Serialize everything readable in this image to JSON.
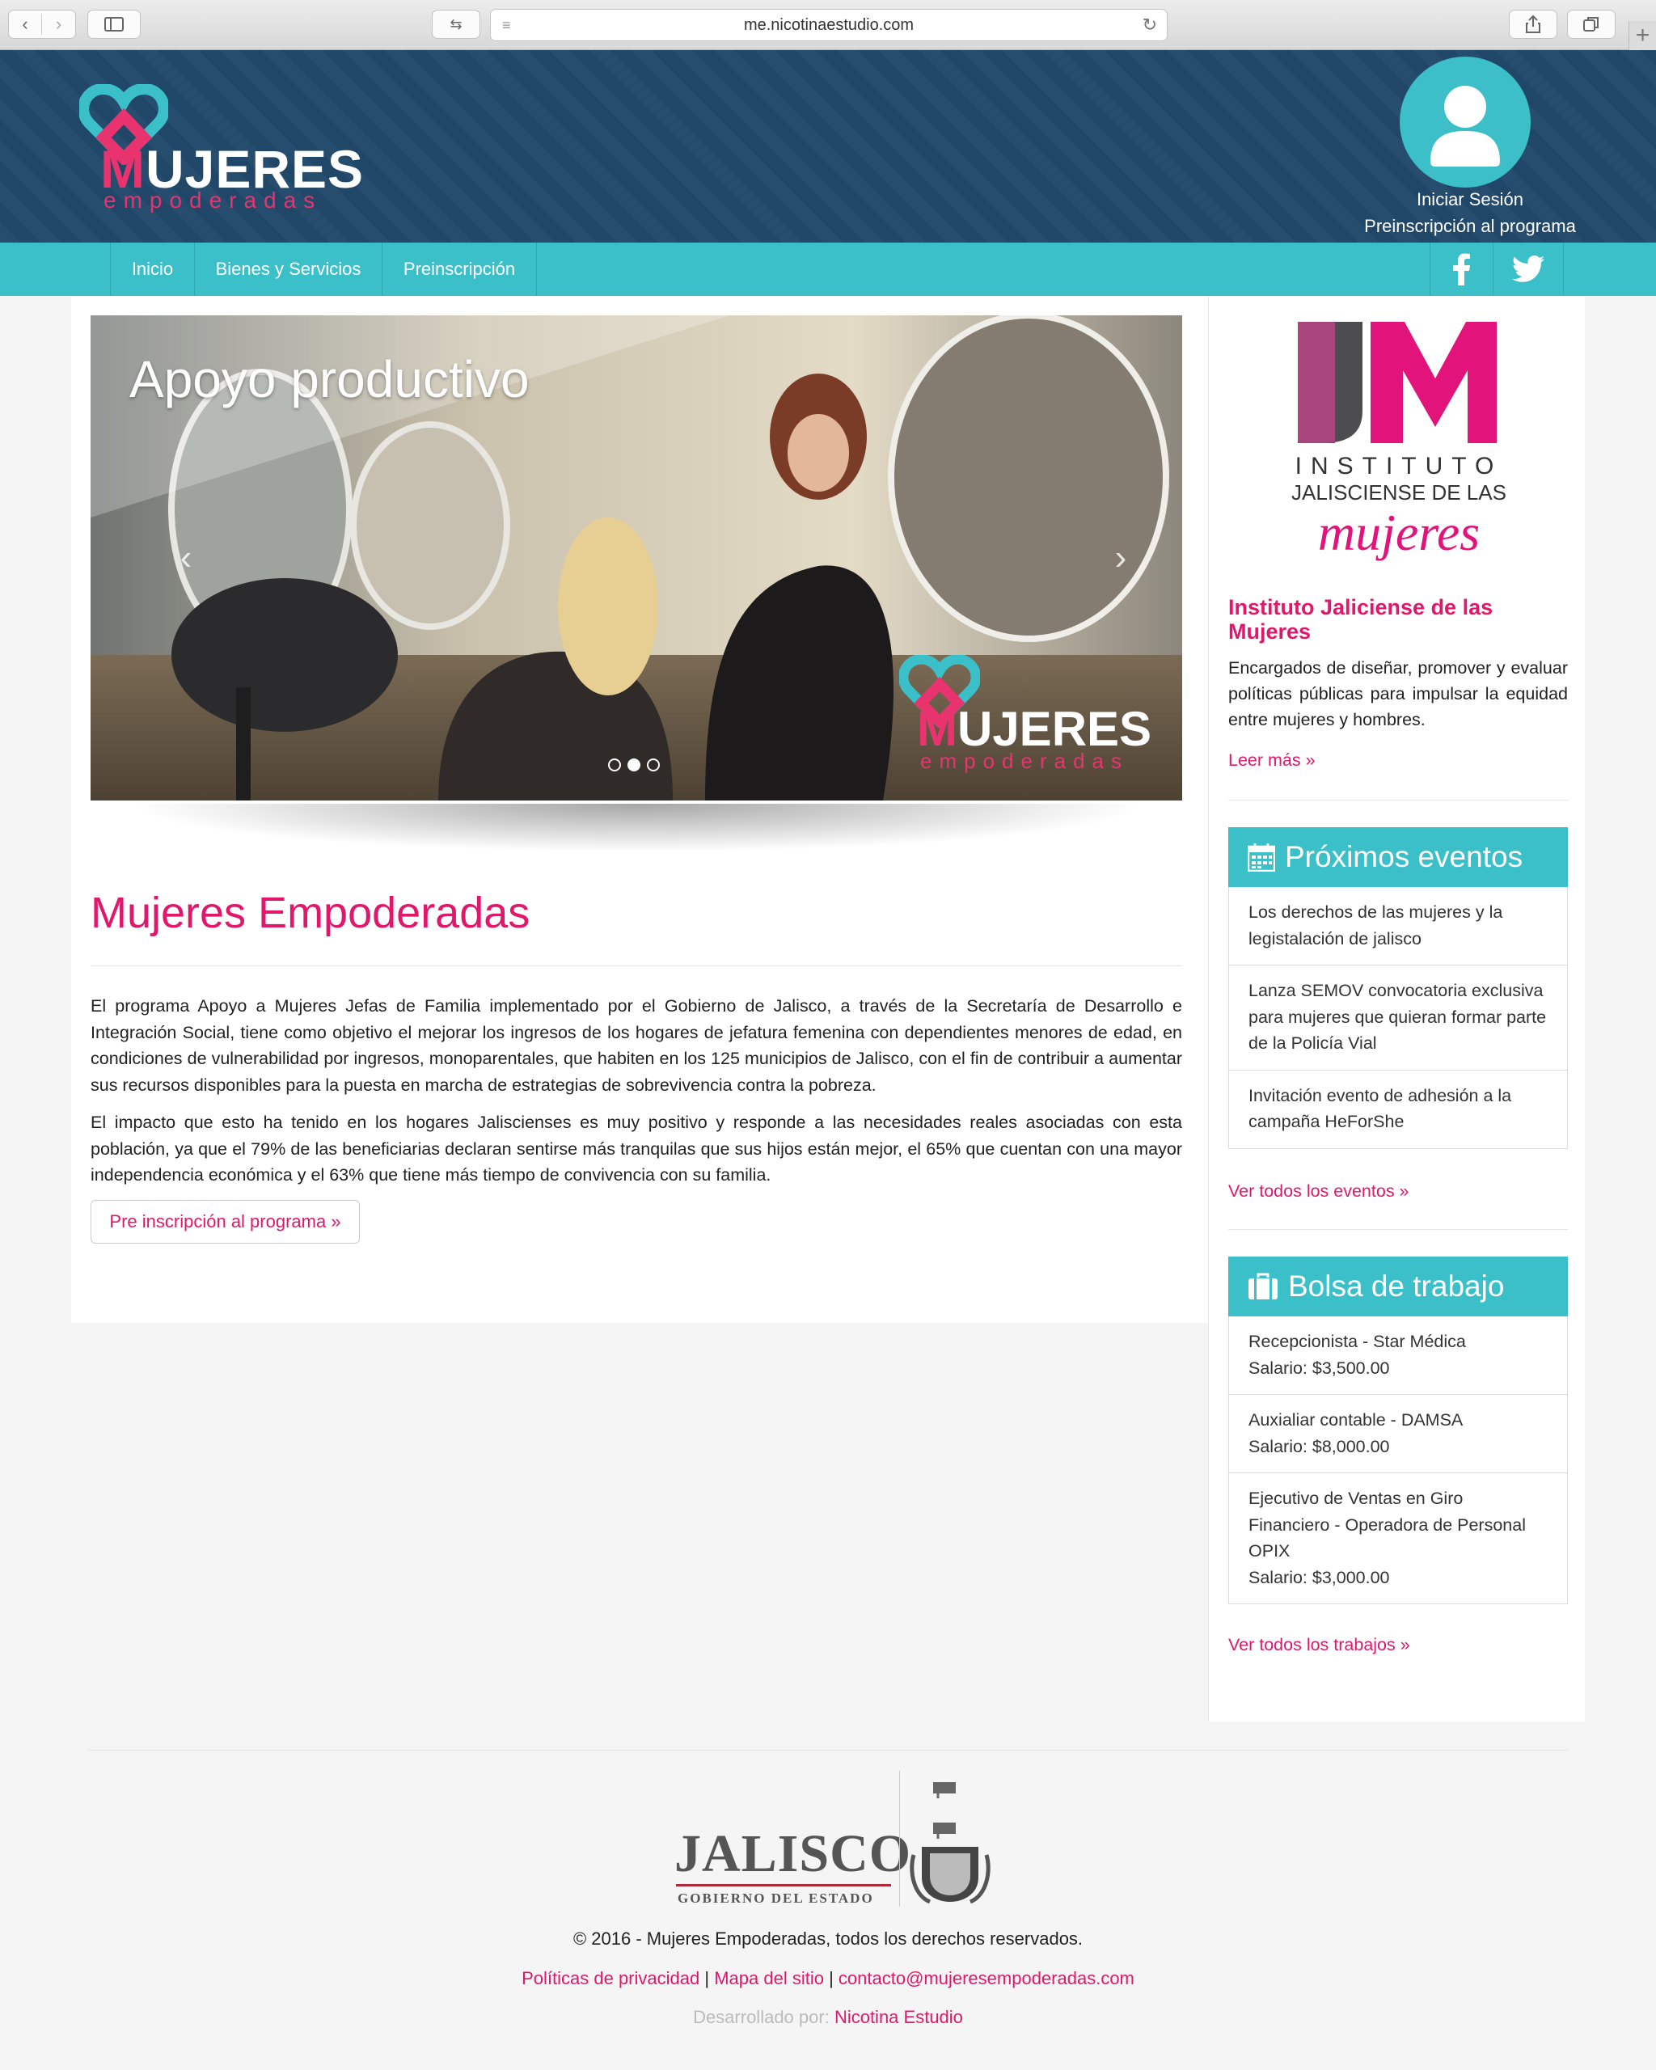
{
  "browser": {
    "url": "me.nicotinaestudio.com"
  },
  "header": {
    "logo_word_m": "M",
    "logo_word_rest": "UJERES",
    "logo_sub": "empoderadas",
    "login_label": "Iniciar Sesión",
    "preinscription_label": "Preinscripción al programa"
  },
  "nav": {
    "items": [
      "Inicio",
      "Bienes y Servicios",
      "Preinscripción"
    ]
  },
  "slider": {
    "title": "Apoyo productivo",
    "logo_word_m": "M",
    "logo_word_rest": "UJERES",
    "logo_sub": "empoderadas",
    "active_slide": 2,
    "slide_count": 3
  },
  "main": {
    "title": "Mujeres Empoderadas",
    "paragraph1": "El programa Apoyo a Mujeres Jefas de Familia implementado por el Gobierno de Jalisco, a través de la Secretaría de Desarrollo e Integración Social, tiene como objetivo el mejorar los ingresos de los hogares de jefatura femenina con dependientes menores de edad, en condiciones de vulnerabilidad por ingresos, monoparentales, que habiten en los 125 municipios de Jalisco, con el fin de contribuir a aumentar sus recursos disponibles para la puesta en marcha de estrategias de sobrevivencia contra la pobreza.",
    "paragraph2": "El impacto que esto ha tenido en los hogares Jaliscienses es muy positivo y responde a las necesidades reales asociadas con esta población, ya que el 79% de las beneficiarias declaran sentirse más tranquilas que sus hijos están mejor, el 65% que cuentan con una mayor independencia económica y el 63% que tiene más tiempo de convivencia con su familia.",
    "button_label": "Pre inscripción al programa »"
  },
  "sidebar": {
    "ijm_logo": {
      "line1": "INSTITUTO",
      "line2": "JALISCIENSE DE LAS",
      "line3": "mujeres"
    },
    "ijm_title": "Instituto Jaliciense de las Mujeres",
    "ijm_text": "Encargados de diseñar, promover y evaluar políticas públicas para impulsar la equidad entre mujeres y hombres.",
    "ijm_link": "Leer más »",
    "events": {
      "title": "Próximos eventos",
      "items": [
        "Los derechos de las mujeres y la legistalación de jalisco",
        "Lanza SEMOV convocatoria exclusiva para mujeres que quieran formar parte de la Policía Vial",
        "Invitación evento de adhesión a la campaña HeForShe"
      ],
      "link": "Ver todos los eventos »"
    },
    "jobs": {
      "title": "Bolsa de trabajo",
      "items": [
        {
          "name": "Recepcionista - Star Médica",
          "salary": "Salario: $3,500.00"
        },
        {
          "name": "Auxialiar contable - DAMSA",
          "salary": "Salario: $8,000.00"
        },
        {
          "name": "Ejecutivo de Ventas en Giro Financiero - Operadora de Personal OPIX",
          "salary": "Salario: $3,000.00"
        }
      ],
      "link": "Ver todos los trabajos »"
    }
  },
  "footer": {
    "jalisco_word": "JALISCO",
    "jalisco_sub": "GOBIERNO DEL ESTADO",
    "copyright": "© 2016 - Mujeres Empoderadas, todos los derechos reservados.",
    "links": [
      "Políticas de privacidad",
      "Mapa del sitio",
      "contacto@mujeresempoderadas.com"
    ],
    "separator": "|",
    "dev_label": "Desarrollado por:",
    "dev_link": "Nicotina Estudio"
  },
  "colors": {
    "header_bg": "#21496a",
    "accent_teal": "#3bbfc9",
    "accent_pink": "#e0176b"
  }
}
